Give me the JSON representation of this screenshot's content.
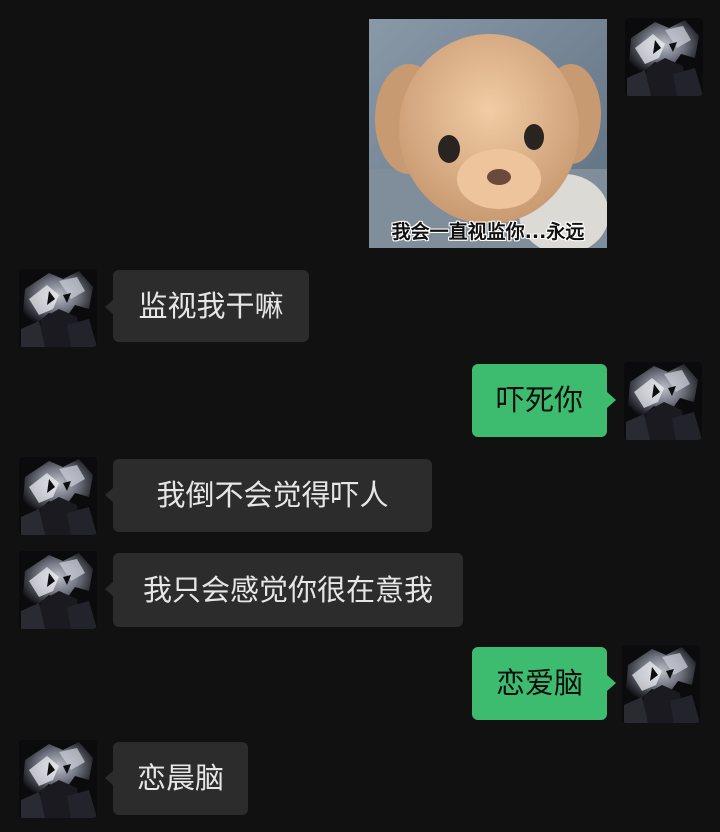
{
  "chat": {
    "sticker": {
      "caption": "我会一直视监你...永远",
      "icon": "puppy-sticker"
    },
    "messages": [
      {
        "side": "left",
        "text": "监视我干嘛"
      },
      {
        "side": "right",
        "text": "吓死你"
      },
      {
        "side": "left",
        "text": "我倒不会觉得吓人"
      },
      {
        "side": "left",
        "text": "我只会感觉你很在意我"
      },
      {
        "side": "right",
        "text": "恋爱脑"
      },
      {
        "side": "left",
        "text": "恋晨脑"
      }
    ]
  },
  "colors": {
    "background": "#111111",
    "incoming_bubble": "#2c2c2c",
    "outgoing_bubble": "#3dbb6e"
  }
}
